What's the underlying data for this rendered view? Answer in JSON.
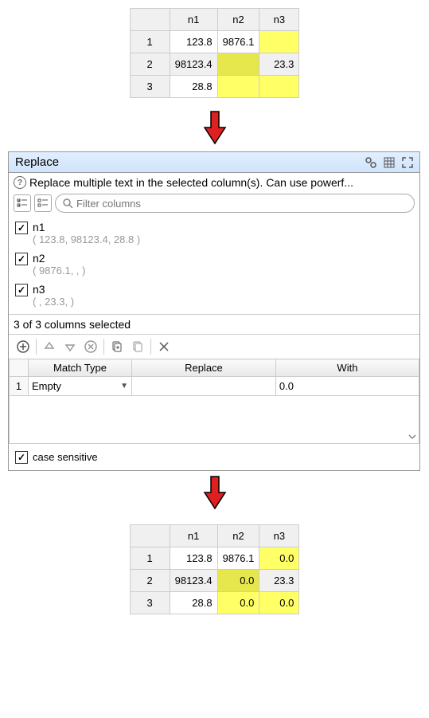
{
  "table_before": {
    "columns": [
      "n1",
      "n2",
      "n3"
    ],
    "rows": [
      {
        "idx": "1",
        "cells": [
          "123.8",
          "9876.1",
          ""
        ],
        "hl": [
          false,
          false,
          true
        ]
      },
      {
        "idx": "2",
        "cells": [
          "98123.4",
          "",
          "23.3"
        ],
        "hl": [
          false,
          true,
          false
        ]
      },
      {
        "idx": "3",
        "cells": [
          "28.8",
          "",
          ""
        ],
        "hl": [
          false,
          true,
          true
        ]
      }
    ]
  },
  "table_after": {
    "columns": [
      "n1",
      "n2",
      "n3"
    ],
    "rows": [
      {
        "idx": "1",
        "cells": [
          "123.8",
          "9876.1",
          "0.0"
        ],
        "hl": [
          false,
          false,
          true
        ]
      },
      {
        "idx": "2",
        "cells": [
          "98123.4",
          "0.0",
          "23.3"
        ],
        "hl": [
          false,
          true,
          false
        ]
      },
      {
        "idx": "3",
        "cells": [
          "28.8",
          "0.0",
          "0.0"
        ],
        "hl": [
          false,
          true,
          true
        ]
      }
    ]
  },
  "dialog": {
    "title": "Replace",
    "help": "Replace multiple text in the selected column(s). Can use powerf...",
    "filter_placeholder": "Filter columns",
    "columns": [
      {
        "name": "n1",
        "preview": "( 123.8, 98123.4, 28.8 )",
        "checked": true
      },
      {
        "name": "n2",
        "preview": "( 9876.1, , )",
        "checked": true
      },
      {
        "name": "n3",
        "preview": "( , 23.3, )",
        "checked": true
      }
    ],
    "selection_status": "3 of 3 columns selected",
    "rule_headers": {
      "match": "Match Type",
      "replace": "Replace",
      "with": "With"
    },
    "rules": [
      {
        "idx": "1",
        "match_type": "Empty",
        "replace": "",
        "with": "0.0"
      }
    ],
    "case_sensitive_label": "case sensitive",
    "case_sensitive_checked": true
  }
}
